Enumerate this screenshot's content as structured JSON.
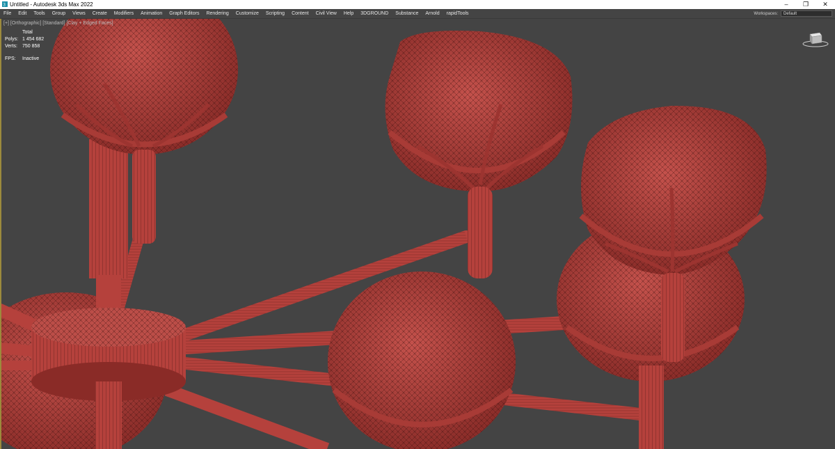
{
  "titlebar": {
    "title": "Untitled - Autodesk 3ds Max 2022",
    "minimize": "–",
    "restore": "❐",
    "close": "✕"
  },
  "menubar": {
    "items": [
      "File",
      "Edit",
      "Tools",
      "Group",
      "Views",
      "Create",
      "Modifiers",
      "Animation",
      "Graph Editors",
      "Rendering",
      "Customize",
      "Scripting",
      "Content",
      "Civil View",
      "Help",
      "3DGROUND",
      "Substance",
      "Arnold",
      "rapidTools"
    ],
    "workspace_label": "Workspaces:",
    "workspace_value": "Default"
  },
  "viewport": {
    "label": "[+] [Orthographic] [Standard] [Clay + Edged Faces]",
    "stats": {
      "header": "Total",
      "polys_label": "Polys:",
      "polys_value": "1 454 682",
      "verts_label": "Verts:",
      "verts_value": "750 858",
      "fps_label": "FPS:",
      "fps_value": "Inactive"
    }
  },
  "colors": {
    "background": "#444444",
    "mesh": "#b5413c",
    "wire": "#3a0f0d",
    "viewport_border": "#9c8a3c"
  },
  "icons": [
    "app-icon",
    "viewcube-icon"
  ]
}
